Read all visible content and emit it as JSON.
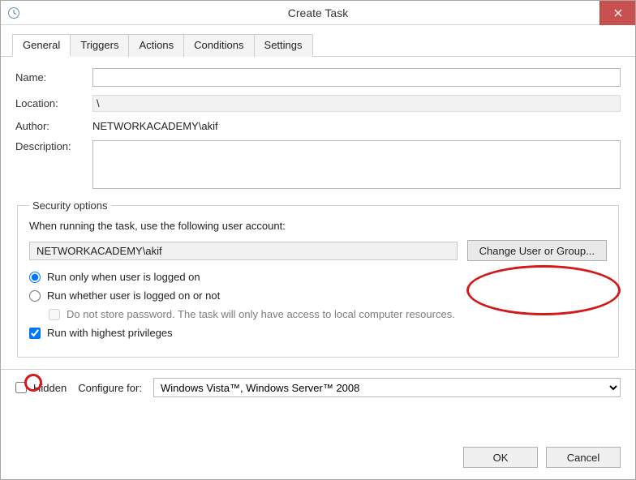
{
  "window": {
    "title": "Create Task"
  },
  "tabs": {
    "general": "General",
    "triggers": "Triggers",
    "actions": "Actions",
    "conditions": "Conditions",
    "settings": "Settings"
  },
  "general": {
    "name_label": "Name:",
    "name_value": "",
    "location_label": "Location:",
    "location_value": "\\",
    "author_label": "Author:",
    "author_value": "NETWORKACADEMY\\akif",
    "desc_label": "Description:",
    "desc_value": ""
  },
  "security": {
    "legend": "Security options",
    "when_running": "When running the task, use the following user account:",
    "user_account": "NETWORKACADEMY\\akif",
    "change_user_button": "Change User or Group...",
    "run_logged_on": "Run only when user is logged on",
    "run_whether": "Run whether user is logged on or not",
    "do_not_store": "Do not store password.  The task will only have access to local computer resources.",
    "highest_priv": "Run with highest privileges"
  },
  "bottom": {
    "hidden_label": "Hidden",
    "configure_label": "Configure for:",
    "configure_value": "Windows Vista™, Windows Server™ 2008"
  },
  "footer": {
    "ok": "OK",
    "cancel": "Cancel"
  }
}
